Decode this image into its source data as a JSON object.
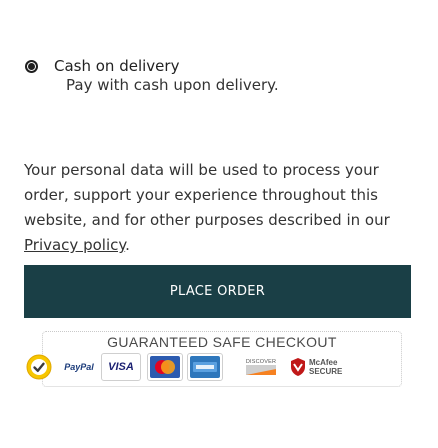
{
  "payment": {
    "option_label": "Cash on delivery",
    "option_description": "Pay with cash upon delivery."
  },
  "privacy": {
    "text_before": "Your personal data will be used to process your order, support your experience throughout this website, and for other purposes described in our ",
    "link_label": "Privacy policy",
    "text_after": "."
  },
  "checkout": {
    "place_order_label": "PLACE ORDER"
  },
  "guarantee": {
    "title": "GUARANTEED SAFE CHECKOUT",
    "badges": {
      "paypal": "PayPal",
      "visa": "VISA",
      "discover": "DISCOVER",
      "mcafee_1": "McAfee",
      "mcafee_2": "SECURE"
    }
  },
  "colors": {
    "button_bg": "#1a3f46",
    "visa_blue": "#1a1f71",
    "mastercard_red": "#eb001b",
    "discover_orange": "#f68121"
  }
}
